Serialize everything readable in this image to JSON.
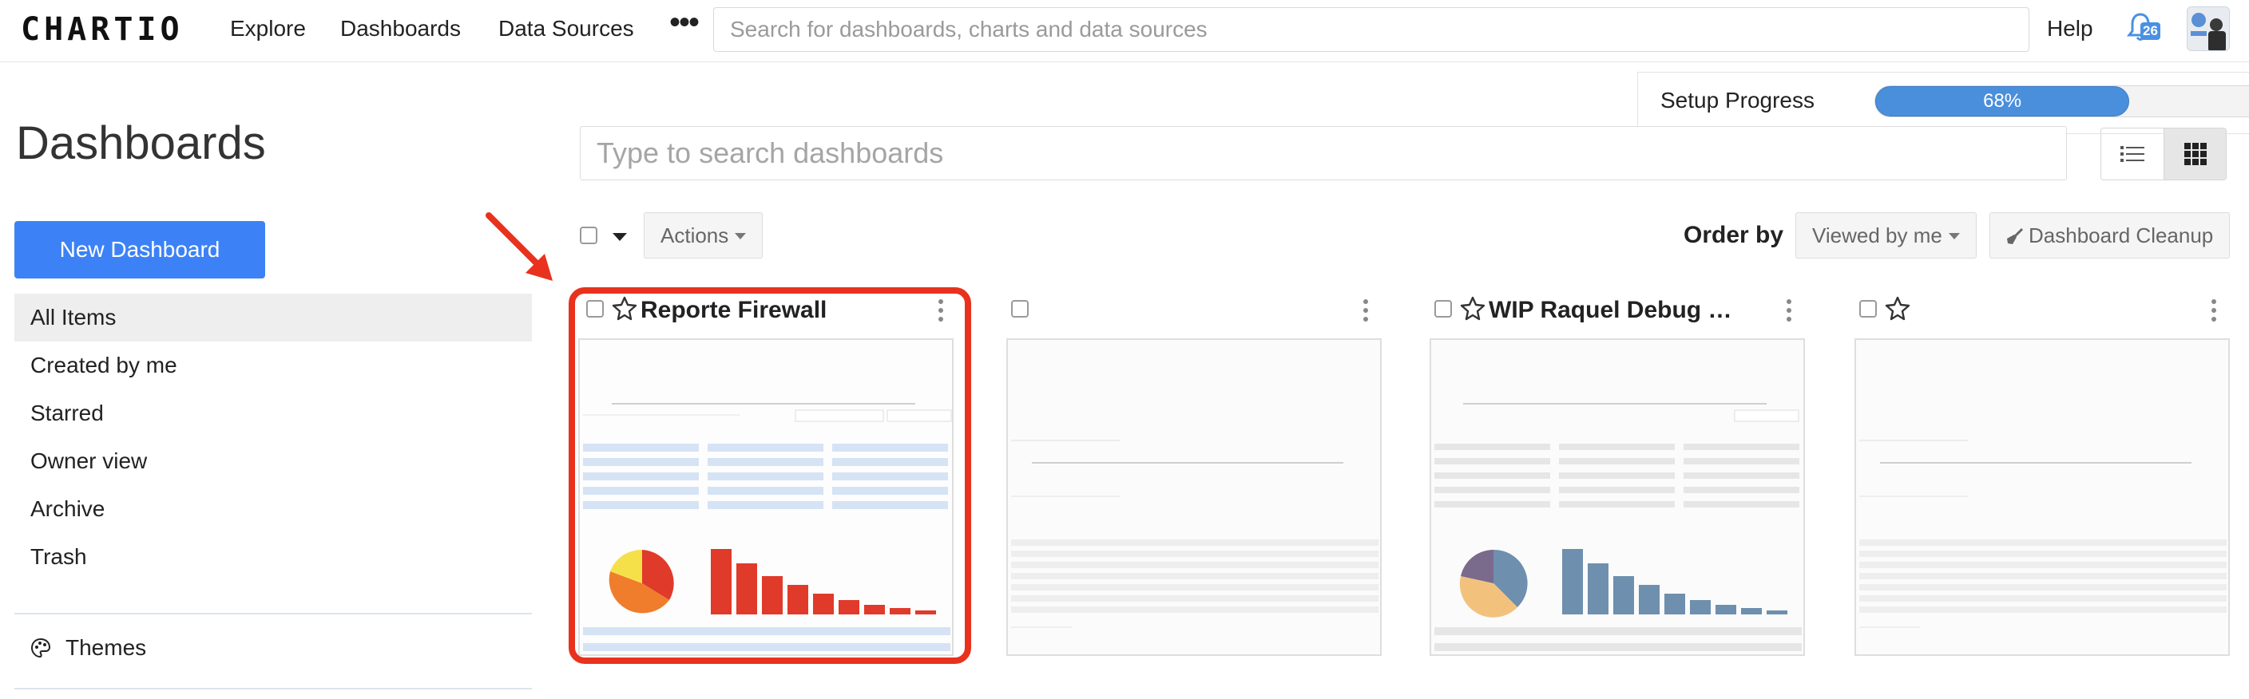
{
  "topbar": {
    "logo": "CHARTIO",
    "nav": [
      "Explore",
      "Dashboards",
      "Data Sources"
    ],
    "more": "•••",
    "search_placeholder": "Search for dashboards, charts and data sources",
    "help": "Help",
    "notification_count": "26"
  },
  "setup": {
    "label": "Setup Progress",
    "progress": 68,
    "progress_text": "68%"
  },
  "sidebar": {
    "title": "Dashboards",
    "new_button": "New Dashboard",
    "items": [
      {
        "label": "All Items",
        "active": true
      },
      {
        "label": "Created by me",
        "active": false
      },
      {
        "label": "Starred",
        "active": false
      },
      {
        "label": "Owner view",
        "active": false
      },
      {
        "label": "Archive",
        "active": false
      },
      {
        "label": "Trash",
        "active": false
      }
    ],
    "themes": "Themes"
  },
  "toolbar": {
    "search_placeholder": "Type to search dashboards",
    "actions": "Actions",
    "order_label": "Order by",
    "order_value": "Viewed by me",
    "cleanup": "Dashboard Cleanup"
  },
  "cards": [
    {
      "title": "Reporte Firewall",
      "starred_icon": true,
      "highlighted": true
    },
    {
      "title": "",
      "starred_icon": false,
      "highlighted": false
    },
    {
      "title": "WIP Raquel Debug Ex...",
      "starred_icon": true,
      "highlighted": false
    },
    {
      "title": "",
      "starred_icon": true,
      "highlighted": false
    }
  ],
  "colors": {
    "primary": "#3c82f6",
    "progress": "#4a8fdc",
    "highlight": "#e8321e",
    "chart_red": "#e03a2a",
    "chart_blue": "#6e8fae"
  }
}
